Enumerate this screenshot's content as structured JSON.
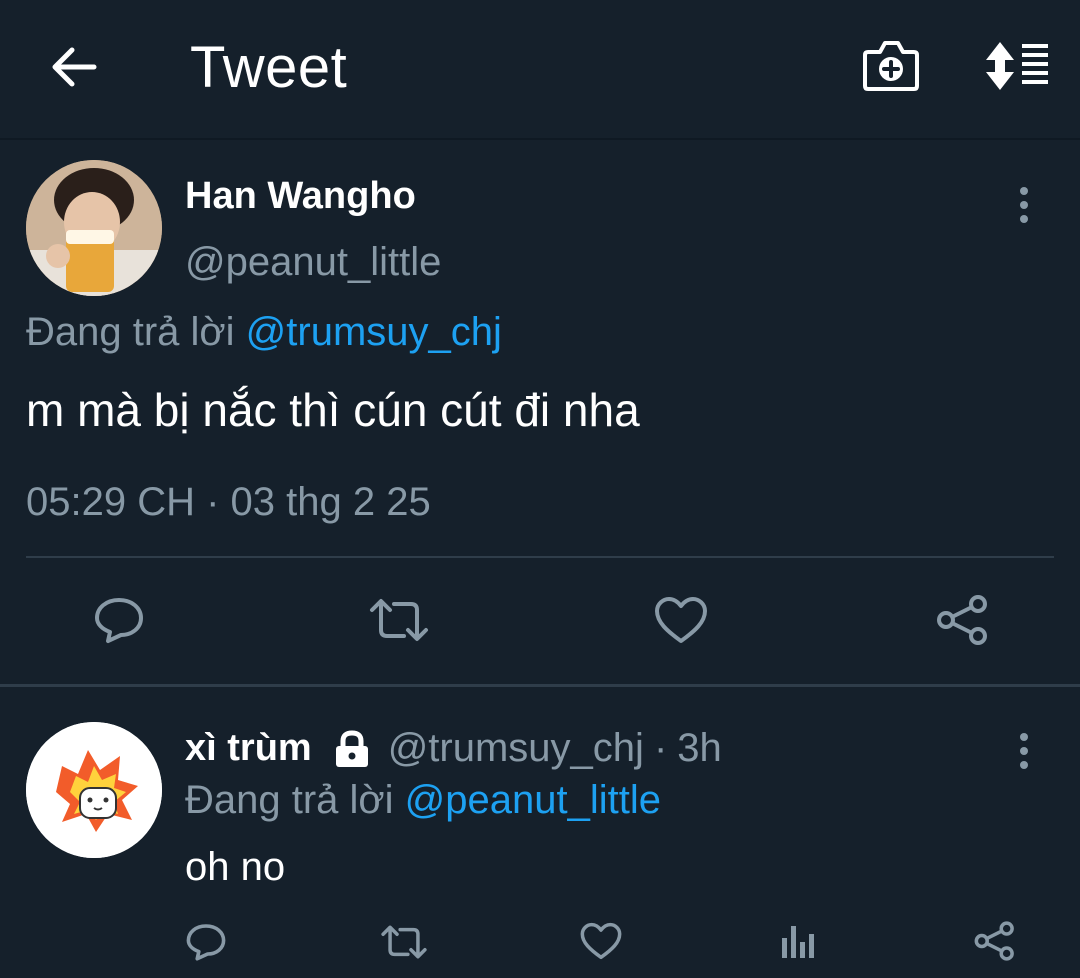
{
  "header": {
    "title": "Tweet",
    "back_icon": "arrow-left-icon",
    "camera_icon": "camera-plus-icon",
    "sort_icon": "sort-lines-icon"
  },
  "main_tweet": {
    "name": "Han Wangho",
    "handle": "@peanut_little",
    "replying_prefix": "Đang trả lời",
    "replying_to": "@trumsuy_chj",
    "text": "m mà bị nắc thì cún cút đi nha",
    "timestamp": "05:29 CH · 03 thg 2 25"
  },
  "reply_tweet": {
    "name": "xì trùm",
    "handle": "@trumsuy_chj",
    "dot": "·",
    "time": "3h",
    "replying_prefix": "Đang trả lời",
    "replying_to": "@peanut_little",
    "text": "oh no"
  },
  "colors": {
    "background": "#15202b",
    "accent": "#1da1f2",
    "muted": "#8899a6"
  }
}
